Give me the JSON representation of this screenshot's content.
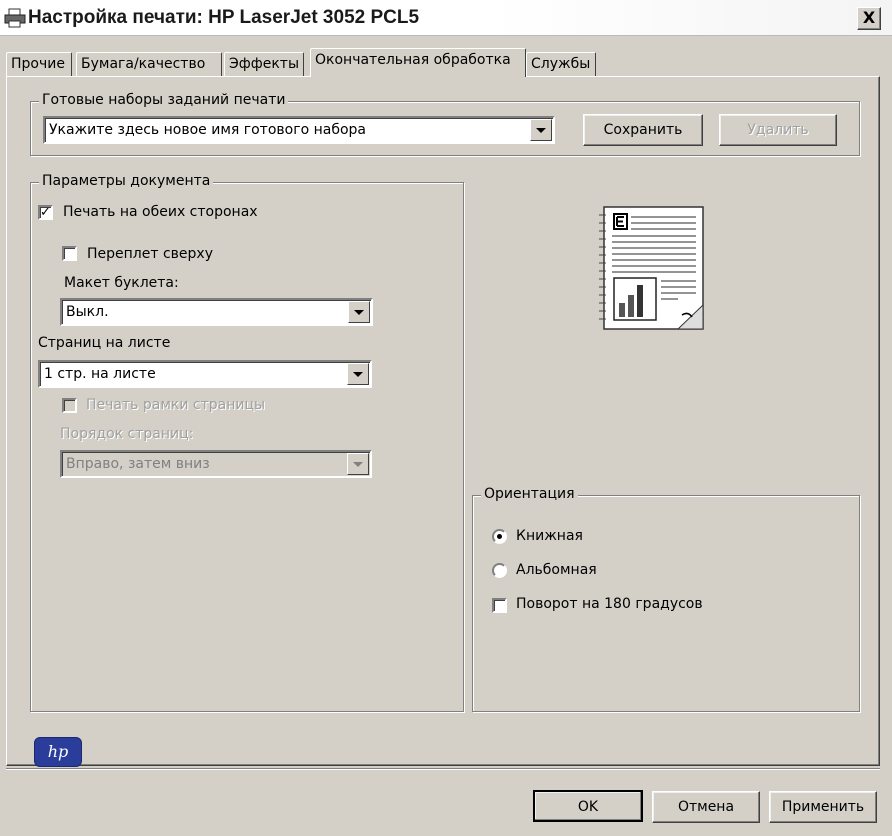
{
  "window": {
    "title": "Настройка печати: HP LaserJet 3052 PCL5",
    "close_label": "X"
  },
  "tabs": [
    {
      "label": "Прочие"
    },
    {
      "label": "Бумага/качество"
    },
    {
      "label": "Эффекты"
    },
    {
      "label": "Окончательная обработка",
      "active": true
    },
    {
      "label": "Службы"
    }
  ],
  "presets": {
    "group_title": "Готовые наборы заданий печати",
    "combo_value": "Укажите здесь новое имя готового набора",
    "save_label": "Сохранить",
    "delete_label": "Удалить"
  },
  "document": {
    "group_title": "Параметры документа",
    "duplex_label": "Печать на обеих сторонах",
    "duplex_checked": true,
    "flip_label": "Переплет сверху",
    "flip_checked": false,
    "booklet_label": "Макет буклета:",
    "booklet_value": "Выкл.",
    "pages_per_sheet_label": "Страниц на листе",
    "pages_per_sheet_value": "1 стр. на листе",
    "border_label": "Печать рамки страницы",
    "order_label": "Порядок страниц:",
    "order_value": "Вправо, затем вниз"
  },
  "orientation": {
    "group_title": "Ориентация",
    "portrait_label": "Книжная",
    "landscape_label": "Альбомная",
    "rotate_label": "Поворот на 180 градусов",
    "selected": "portrait"
  },
  "logo": {
    "text": "hp"
  },
  "footer": {
    "ok_label": "OK",
    "cancel_label": "Отмена",
    "apply_label": "Применить"
  },
  "colors": {
    "dialog_bg": "#d4d0c8",
    "hp_blue": "#2b3d9b"
  }
}
